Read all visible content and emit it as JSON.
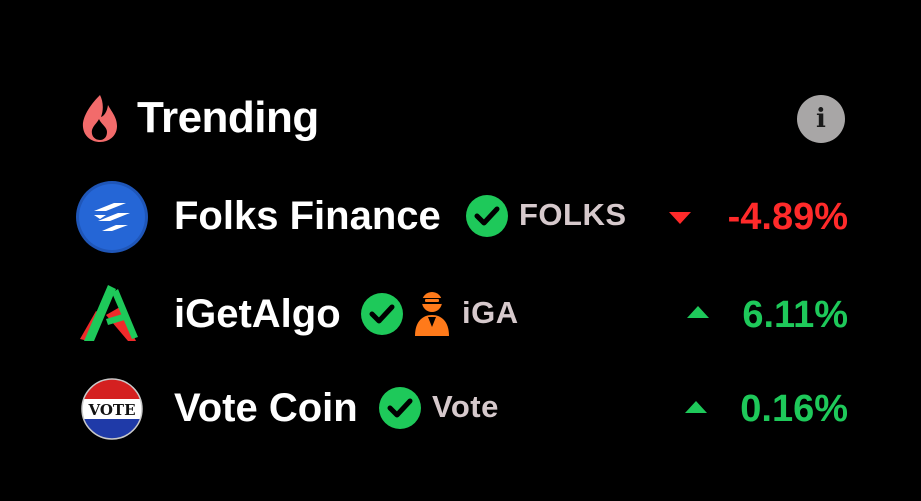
{
  "header": {
    "title": "Trending",
    "icon": "flame-icon",
    "info_label": "i"
  },
  "colors": {
    "up": "#1ec95a",
    "down": "#ff2a2a",
    "verified": "#1ec95a",
    "ticker": "#d6c9cc",
    "flame": "#f26b6b"
  },
  "items": [
    {
      "name": "Folks Finance",
      "ticker": "FOLKS",
      "change": "-4.89%",
      "direction": "down",
      "verified": true,
      "logo": "folks-finance-logo"
    },
    {
      "name": "iGetAlgo",
      "ticker": "iGA",
      "change": "6.11%",
      "direction": "up",
      "verified": true,
      "logo": "igetalgo-logo",
      "extra_badge": "user-avatar-icon"
    },
    {
      "name": "Vote Coin",
      "ticker": "Vote",
      "change": "0.16%",
      "direction": "up",
      "verified": true,
      "logo": "vote-coin-logo",
      "logo_text": "VOTE"
    }
  ]
}
